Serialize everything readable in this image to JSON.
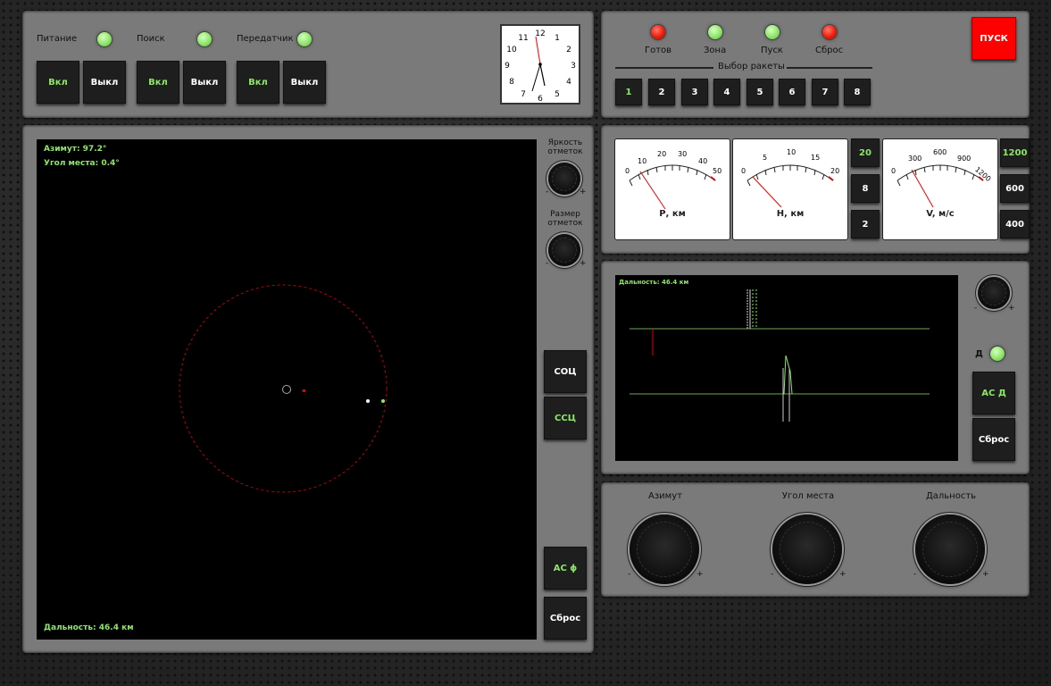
{
  "power": {
    "groups": [
      {
        "label": "Питание",
        "on": "Вкл",
        "off": "Выкл"
      },
      {
        "label": "Поиск",
        "on": "Вкл",
        "off": "Выкл"
      },
      {
        "label": "Передатчик",
        "on": "Вкл",
        "off": "Выкл"
      }
    ]
  },
  "clock": {
    "numbers": [
      "12",
      "1",
      "2",
      "3",
      "4",
      "5",
      "6",
      "7",
      "8",
      "9",
      "10",
      "11"
    ]
  },
  "status": {
    "indicators": [
      {
        "label": "Готов",
        "state": "red"
      },
      {
        "label": "Зона",
        "state": "green"
      },
      {
        "label": "Пуск",
        "state": "green"
      },
      {
        "label": "Сброс",
        "state": "red"
      }
    ],
    "launch_button": "ПУСК",
    "missile_select_title": "Выбор ракеты",
    "missiles": [
      "1",
      "2",
      "3",
      "4",
      "5",
      "6",
      "7",
      "8"
    ],
    "selected_missile": "1"
  },
  "radar": {
    "azimuth": "Азимут: 97.2°",
    "elevation": "Угол места: 0.4°",
    "distance": "Дальность: 46.4 км",
    "brightness_label": "Яркость отметок",
    "size_label": "Размер отметок",
    "soc_button": "СОЦ",
    "ssc_button": "ССЦ",
    "as_phi_button": "АС ϕ",
    "reset_button": "Сброс"
  },
  "meters": {
    "p": {
      "label": "Р, км",
      "ticks": [
        "0",
        "10",
        "20",
        "30",
        "40",
        "50"
      ]
    },
    "h": {
      "label": "Н, км",
      "ticks": [
        "0",
        "5",
        "10",
        "15",
        "20"
      ]
    },
    "v": {
      "label": "V, м/с",
      "ticks": [
        "0",
        "300",
        "600",
        "900",
        "1200"
      ]
    },
    "p_range_buttons": [
      "20",
      "8",
      "2"
    ],
    "v_range_buttons": [
      "1200",
      "600",
      "400"
    ]
  },
  "scope": {
    "distance": "Дальность: 46.4 км",
    "d_label": "Д",
    "as_d_button": "АС Д",
    "reset_button": "Сброс"
  },
  "knobs": {
    "azimuth": "Азимут",
    "elevation": "Угол места",
    "range": "Дальность"
  },
  "signs": {
    "minus": "-",
    "plus": "+"
  }
}
